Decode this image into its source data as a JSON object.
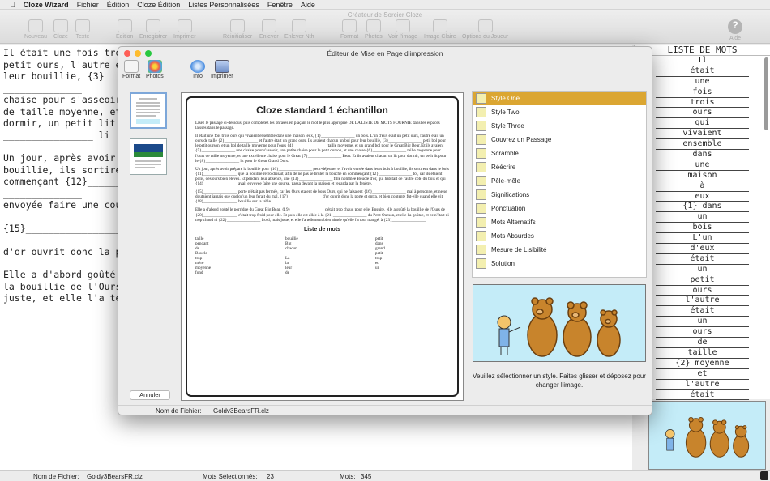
{
  "menubar": {
    "app": "Cloze Wizard",
    "items": [
      "Fichier",
      "Édition",
      "Cloze Édition",
      "Listes Personnalisées",
      "Fenêtre",
      "Aide"
    ]
  },
  "window": {
    "title": "Créateur de Sorcier Cloze"
  },
  "toolbar": {
    "nouveau": "Nouveau",
    "cloze": "Cloze",
    "texte": "Texte",
    "edition": "Édition",
    "enregistrer": "Enregistrer",
    "imprimer": "Imprimer",
    "reinitialiser": "Réinitialiser",
    "enlever": "Enlever",
    "enlever_nth": "Enlever Nth",
    "format": "Format",
    "photos": "Photos",
    "voir_image": "Voir l'image",
    "image_claire": "Image Claire",
    "options_joueur": "Options du Joueur",
    "aide": "Aide"
  },
  "document": {
    "lines": [
      "Il était une fois trois ou",
      "petit ours, l'autre était u",
      "leur bouillie, {3}",
      "______________",
      "chaise pour s'asseoir, un",
      "de taille moyenne, et un",
      "dormir, un petit lit pour",
      "________________ li",
      "Un jour, après avoir pré",
      "bouillie, ils sortirent dan",
      "commençant {12}___________",
      "______________",
      "envoyée faire une cours",
      "{15}___________________",
      "______________________",
      "d'or ouvrit donc la porte",
      "Elle a d'abord goûté le",
      "la bouillie de l'Ours de {",
      "juste, et elle l'a tellem"
    ]
  },
  "word_list": {
    "title": "LISTE DE MOTS",
    "words": [
      "Il",
      "était",
      "une",
      "fois",
      "trois",
      "ours",
      "qui",
      "vivaient",
      "ensemble",
      "dans",
      "une",
      "maison",
      "à",
      "eux",
      "{1} dans",
      "un",
      "bois",
      "L'un",
      "d'eux",
      "était",
      "un",
      "petit",
      "ours",
      "l'autre",
      "était",
      "un",
      "ours",
      "de",
      "taille",
      "{2} moyenne",
      "et",
      "l'autre",
      "était"
    ]
  },
  "statusbar": {
    "filename_label": "Nom de Fichier:",
    "filename": "Goldy3BearsFR.clz",
    "selected_label": "Mots Sélectionnés:",
    "selected": "23",
    "words_label": "Mots:",
    "words": "345"
  },
  "dialog": {
    "title": "Éditeur de Mise en Page d'impression",
    "toolbar": {
      "format": "Format",
      "photos": "Photos",
      "info": "Info",
      "imprimer": "Imprimer"
    },
    "cancel": "Annuler",
    "filename_label": "Nom de Fichier:",
    "filename": "Goldv3BearsFR.clz",
    "instructions": "Veuillez sélectionner un style. Faites glisser et déposez pour changer l'image.",
    "styles": [
      "Style One",
      "Style Two",
      "Style Three",
      "Couvrez un Passage",
      "Scramble",
      "Réécrire",
      "Pêle-mêle",
      "Significations",
      "Ponctuation",
      "Mots Alternatifs",
      "Mots Absurdes",
      "Mesure de Lisibilité",
      "Solution"
    ],
    "selected_style": "Style One",
    "preview": {
      "title": "Cloze standard 1 échantillon",
      "instructions": "Lisez le passage ci-dessous, puis complétez les phrases en plaçant le mot le plus approprié DE LA LISTE DE MOTS FOURNIE dans les espaces laissés dans le passage.",
      "paragraphs": [
        "Il était une fois trois ours qui vivaient ensemble dans une maison leux, {1}________________ un bois. L'un d'eux était un petit ours, l'autre était un ours de taille {2}________________ et l'autre était un grand ours. Ils avaient chacun un bol pour leur bouillie, {3}________________ petit bol pour le petit ourson, et un bol de taille moyenne pour l'ours {4}________________ taille moyenne, et un grand bol pour le Great Big Bear. Et ils avaient {5}________________ une chaise pour s'asseoir, une petite chaise pour le petit ourson, et une chaise {6}________________ taille moyenne pour l'ours de taille moyenne, et une excellente chaise pour le Great {7}________________ Bear. Et ils avaient chacun un lit pour dormir, un petit lit pour le {8}________________ lit pour le Great Grand Ours.",
        "Un jour, après avoir préparé la bouillie pour {10}________________ petit-déjeuner et l'avoir versée dans leurs bols à bouillie, ils sortirent dans le bois {11}________________ que la bouillie refroidissait, afin de ne pas se brûler la bouche en commençant {12}________________ tôt, car ils étaient polis, des ours bien élevés. Et pendant leur absence, une {13}________________ fille nommée Boucle d'or, qui habitait de l'autre côté du bois et qui {14}________________ avait envoyée faire une course, passa devant la maison et regarda par la fenêtre.",
        "{15}________________ porte n'était pas fermée, car les Ours étaient de bons Ours, qui ne faisaient {16}________________ mal à personne, et ne se doutaient jamais que quelqu'un leur ferait du mal. {17}________________ d'or ouvrit donc la porte et entra, et bien contente fut-elle quand elle vit {18}________________ bouillie sur la table.",
        "Elle a d'abord goûté le porridge du Great Big Bear, {19}________________ c'était trop chaud pour elle. Ensuite, elle a goûté la bouillie de l'Ours de {20}________________ c'était trop froid pour elle. Et puis elle est allée à la {21}________________ du Petit Ourson, et elle l'a goûtée, et ce n'était ni trop chaud ni {22}________________ froid, mais juste, et elle l'a tellement bien aimée qu'elle l'a tout mangé, à {23}________________"
      ],
      "wordlist_title": "Liste de mots",
      "wordlist": [
        "taille",
        "bouillie",
        "petit",
        "pendant",
        "Big",
        "dans",
        "de",
        "chacun",
        "grand",
        "Boucle",
        "",
        "petit",
        "trop",
        "La",
        "trop",
        "mère",
        "la",
        "et",
        "moyenne",
        "leur",
        "un",
        "fond",
        "de",
        ""
      ]
    }
  },
  "colors": {
    "selection": "#dba632",
    "bear_background": "#c4ecf8",
    "bear_fur": "#c8842c"
  }
}
